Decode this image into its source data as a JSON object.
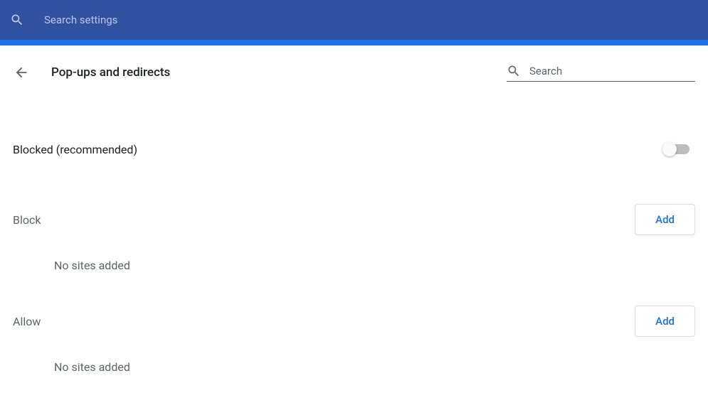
{
  "header": {
    "search_placeholder": "Search settings"
  },
  "page": {
    "title": "Pop-ups and redirects",
    "search_placeholder": "Search"
  },
  "main_setting": {
    "label": "Blocked (recommended)",
    "enabled": false
  },
  "sections": {
    "block": {
      "label": "Block",
      "add_label": "Add",
      "empty": "No sites added"
    },
    "allow": {
      "label": "Allow",
      "add_label": "Add",
      "empty": "No sites added"
    }
  }
}
